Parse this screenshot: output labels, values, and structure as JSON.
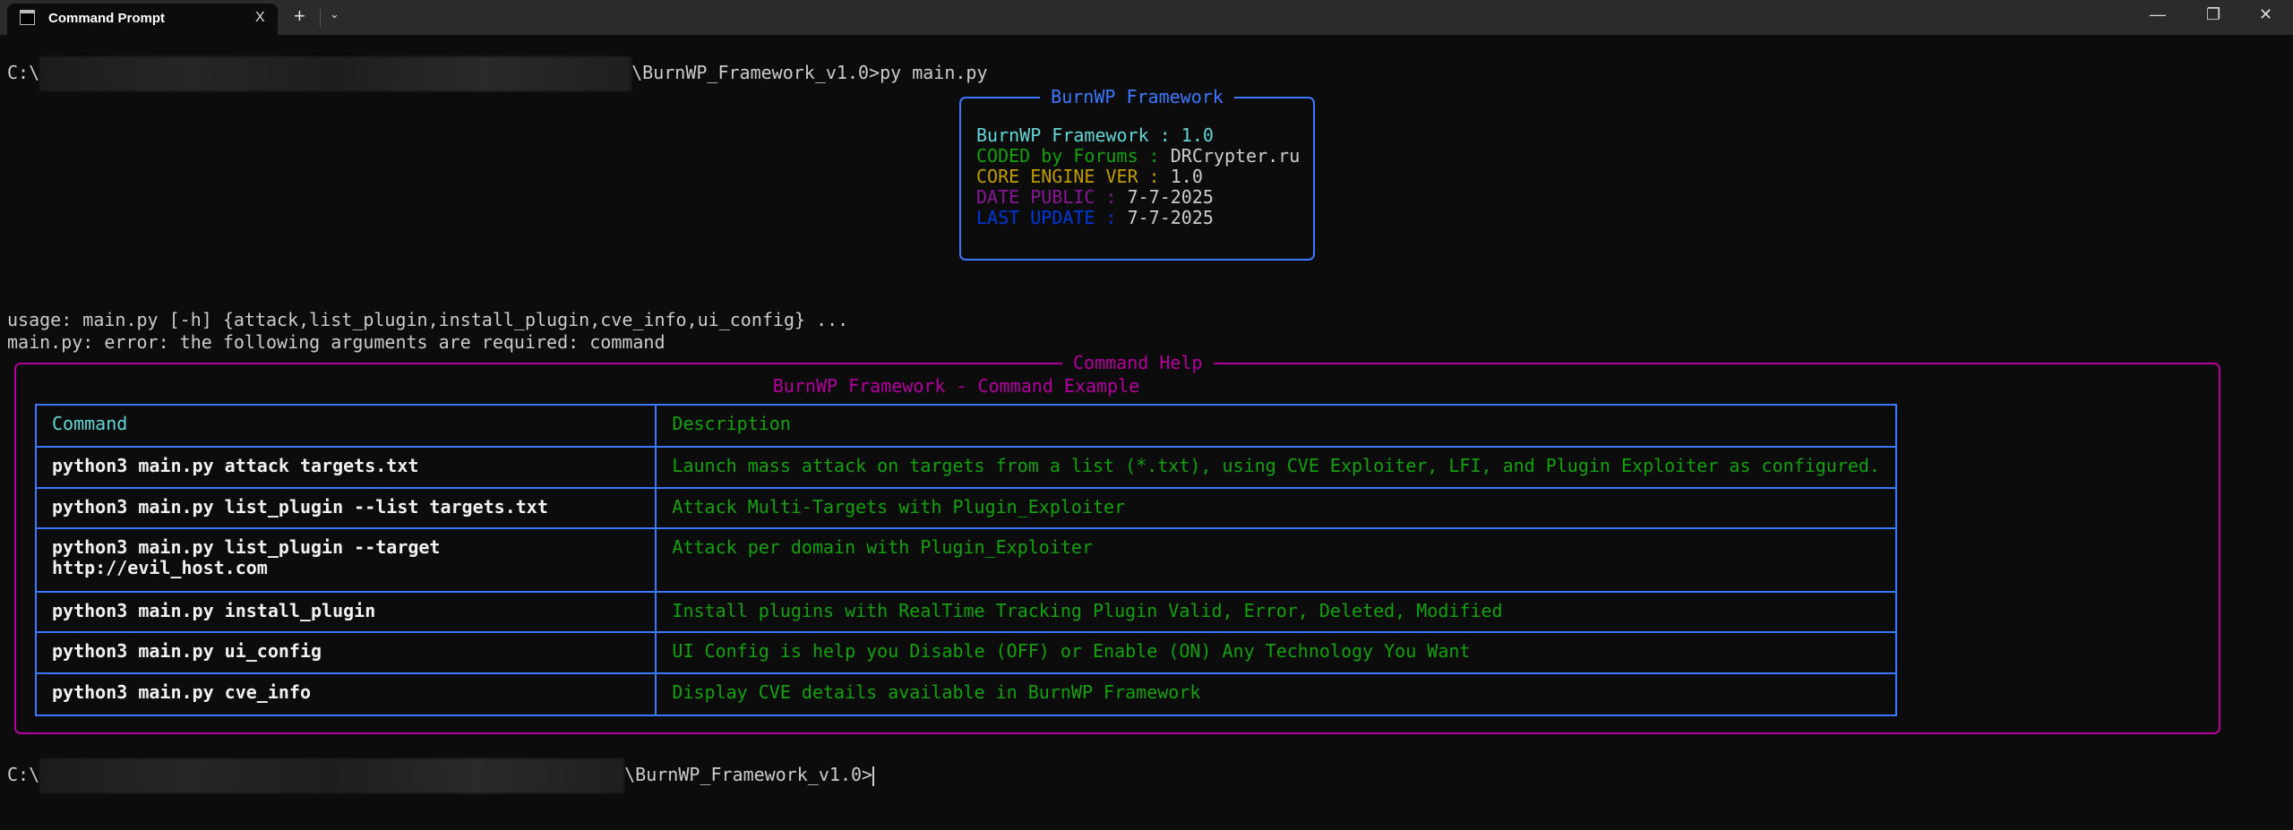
{
  "window": {
    "tab_title": "Command Prompt",
    "new_tab": "+",
    "dropdown": "⌄",
    "minimize": "—",
    "maximize": "❐",
    "close": "✕",
    "tab_close": "X"
  },
  "prompt1": {
    "prefix": "C:\\",
    "suffix": "\\BurnWP_Framework_v1.0>py main.py"
  },
  "info_box": {
    "title": "BurnWP Framework",
    "lines": [
      {
        "label": "BurnWP Framework : 1.0",
        "value": "",
        "color": "#61d6d6"
      },
      {
        "label": "CODED by Forums : ",
        "value": "DRCrypter.ru",
        "color": "#13a10e"
      },
      {
        "label": "CORE ENGINE VER : ",
        "value": "1.0",
        "color": "#c19c00"
      },
      {
        "label": "DATE PUBLIC : ",
        "value": "7-7-2025",
        "color": "#881798"
      },
      {
        "label": "LAST UPDATE : ",
        "value": "7-7-2025",
        "color": "#0037da"
      }
    ]
  },
  "usage": "usage: main.py [-h] {attack,list_plugin,install_plugin,cve_info,ui_config} ...",
  "error": "main.py: error: the following arguments are required: command",
  "help_box": {
    "title": "Command Help",
    "subtitle": "BurnWP Framework - Command Example",
    "headers": [
      "Command",
      "Description"
    ],
    "rows": [
      {
        "command": "python3 main.py attack targets.txt",
        "description": "Launch mass attack on targets from a list (*.txt), using CVE Exploiter, LFI, and Plugin Exploiter as configured."
      },
      {
        "command": "python3 main.py list_plugin --list targets.txt",
        "description": "Attack Multi-Targets with Plugin_Exploiter"
      },
      {
        "command": "python3 main.py list_plugin --target\nhttp://evil_host.com",
        "description": "Attack per domain with Plugin_Exploiter"
      },
      {
        "command": "python3 main.py install_plugin",
        "description": "Install plugins with RealTime Tracking Plugin Valid, Error, Deleted, Modified"
      },
      {
        "command": "python3 main.py ui_config",
        "description": "UI Config is help you Disable (OFF) or Enable (ON) Any Technology You Want"
      },
      {
        "command": "python3 main.py cve_info",
        "description": "Display CVE details available in BurnWP Framework"
      }
    ]
  },
  "prompt2": {
    "prefix": "C:\\",
    "suffix": "\\BurnWP_Framework_v1.0>"
  }
}
